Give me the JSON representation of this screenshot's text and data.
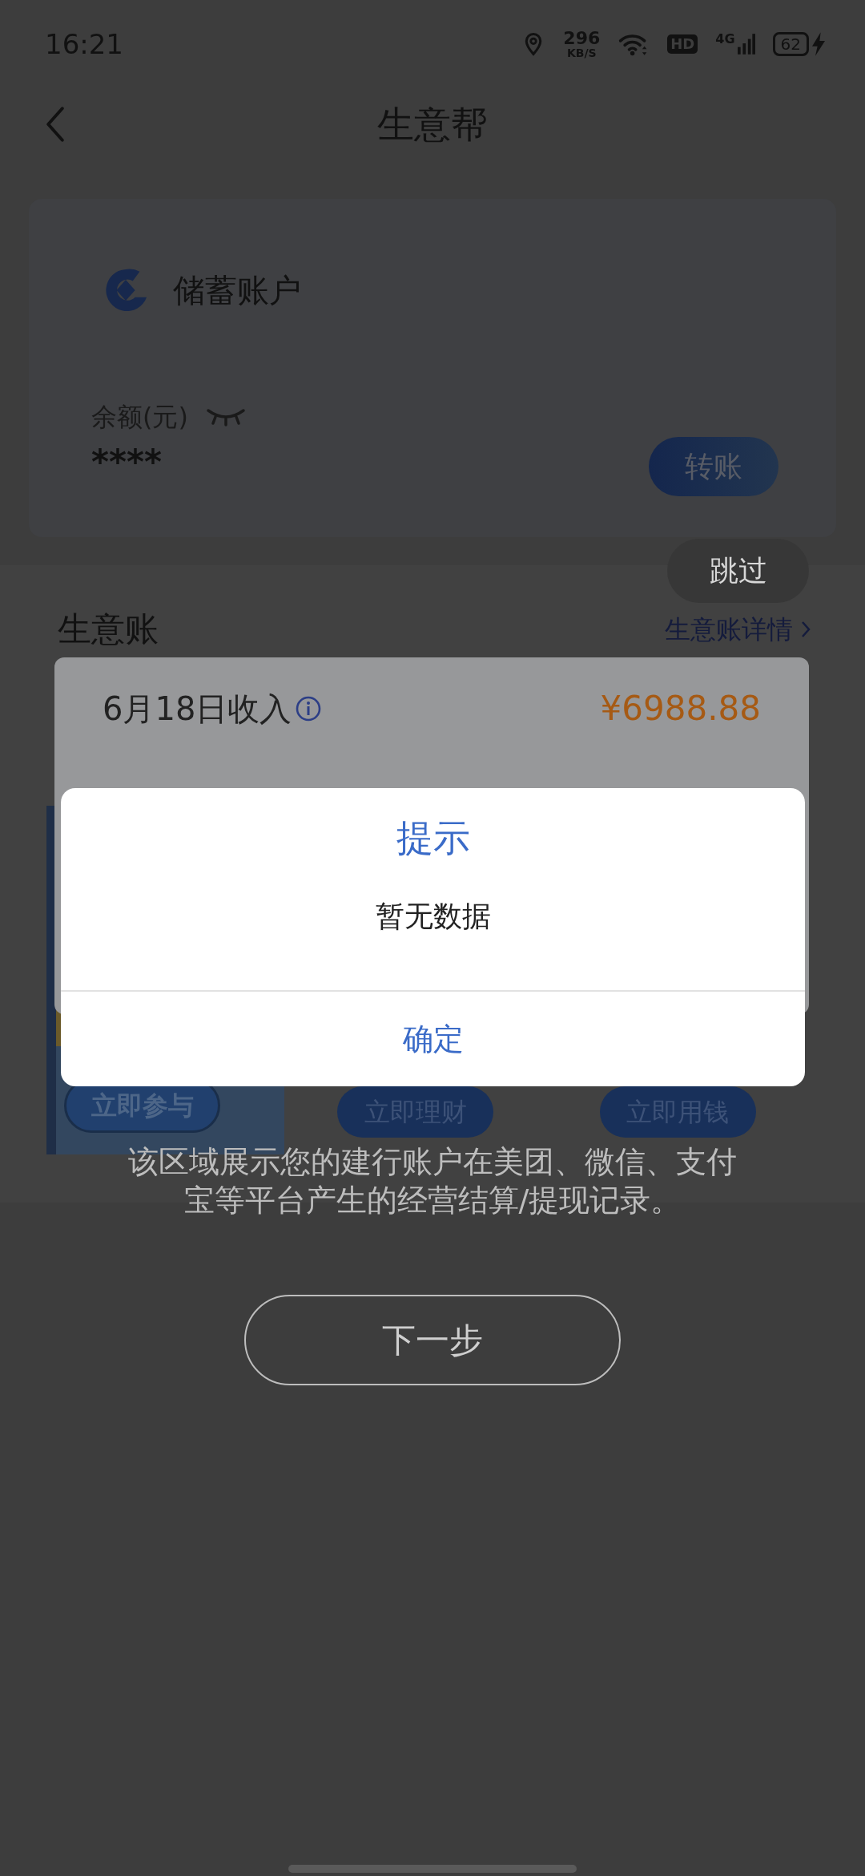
{
  "status_bar": {
    "time": "16:21",
    "net_speed": "296",
    "net_unit": "KB/S",
    "hd": "HD",
    "network": "4G",
    "battery": "62"
  },
  "header": {
    "title": "生意帮"
  },
  "account_card": {
    "name": "储蓄账户",
    "balance_label": "余额(元)",
    "balance": "****",
    "transfer": "转账"
  },
  "business": {
    "title": "生意账",
    "details_link": "生意账详情",
    "income_label": "6月18日收入",
    "income_amount": "¥6988.88"
  },
  "promos": [
    {
      "kind": "picture",
      "button": "立即参与"
    },
    {
      "kind": "plain",
      "button": "立即理财"
    },
    {
      "kind": "plain",
      "button": "立即用钱"
    }
  ],
  "guide": {
    "skip": "跳过",
    "text": "该区域展示您的建行账户在美团、微信、支付宝等平台产生的经营结算/提现记录。",
    "next": "下一步"
  },
  "dialog": {
    "title": "提示",
    "message": "暂无数据",
    "confirm": "确定"
  }
}
